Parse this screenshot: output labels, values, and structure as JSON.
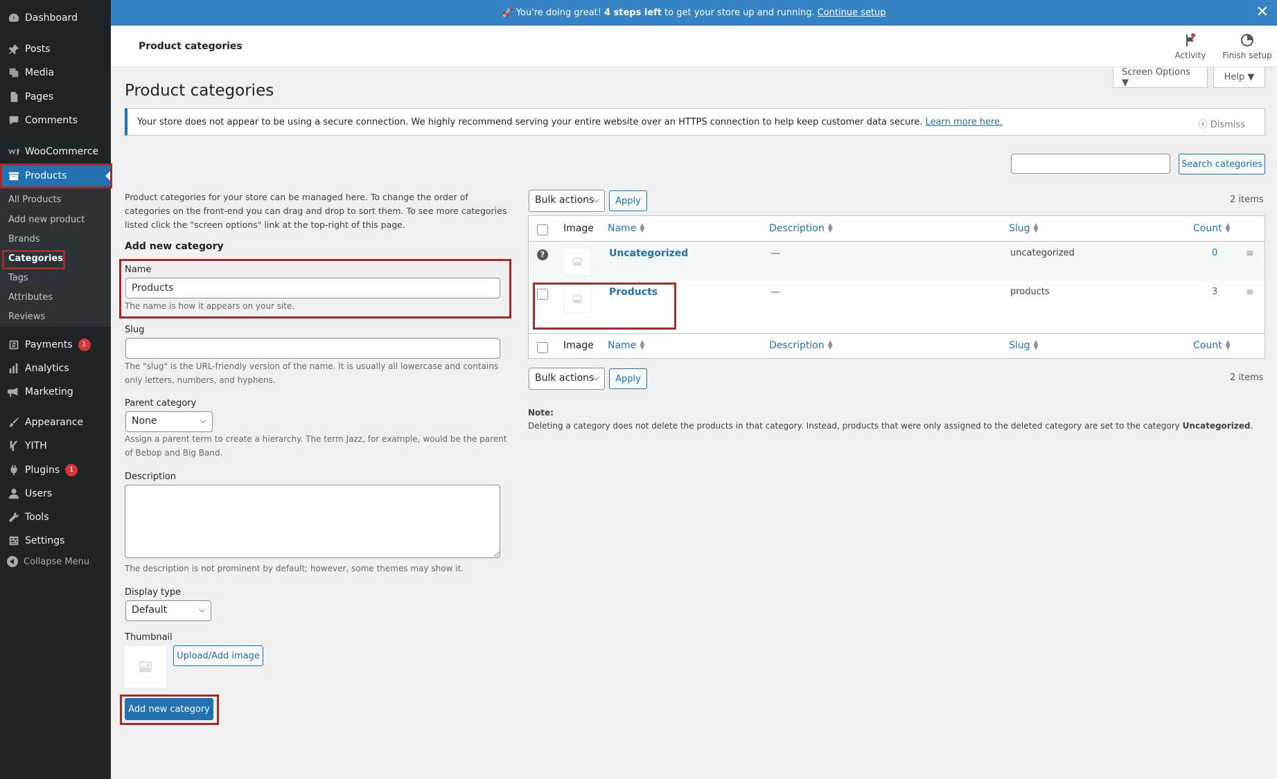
{
  "banner": {
    "prefix": "🚀 You're doing great!",
    "bold": "4 steps left",
    "middle": "to get your store up and running.",
    "link": "Continue setup"
  },
  "sidebar": {
    "items": [
      {
        "label": "Dashboard",
        "icon": "dashboard-icon"
      },
      {
        "label": "Posts",
        "icon": "pin-icon"
      },
      {
        "label": "Media",
        "icon": "media-icon"
      },
      {
        "label": "Pages",
        "icon": "pages-icon"
      },
      {
        "label": "Comments",
        "icon": "comments-icon"
      },
      {
        "label": "WooCommerce",
        "icon": "woocommerce-icon"
      },
      {
        "label": "Products",
        "icon": "archive-icon"
      },
      {
        "label": "Payments",
        "icon": "payments-icon",
        "badge": "1"
      },
      {
        "label": "Analytics",
        "icon": "analytics-icon"
      },
      {
        "label": "Marketing",
        "icon": "megaphone-icon"
      },
      {
        "label": "Appearance",
        "icon": "brush-icon"
      },
      {
        "label": "YITH",
        "icon": "yith-icon"
      },
      {
        "label": "Plugins",
        "icon": "plugins-icon",
        "badge": "1"
      },
      {
        "label": "Users",
        "icon": "users-icon"
      },
      {
        "label": "Tools",
        "icon": "tools-icon"
      },
      {
        "label": "Settings",
        "icon": "settings-icon"
      }
    ],
    "submenu": [
      "All Products",
      "Add new product",
      "Brands",
      "Categories",
      "Tags",
      "Attributes",
      "Reviews"
    ],
    "collapse": "Collapse Menu"
  },
  "header": {
    "title": "Product categories",
    "activity": "Activity",
    "finish_setup": "Finish setup"
  },
  "screen_options": "Screen Options ▼",
  "help": "Help ▼",
  "page_title": "Product categories",
  "notice": {
    "text": "Your store does not appear to be using a secure connection. We highly recommend serving your entire website over an HTTPS connection to help keep customer data secure.",
    "link": "Learn more here.",
    "dismiss": "Dismiss"
  },
  "search": {
    "value": "",
    "button": "Search categories"
  },
  "form": {
    "intro": "Product categories for your store can be managed here. To change the order of categories on the front-end you can drag and drop to sort them. To see more categories listed click the \"screen options\" link at the top-right of this page.",
    "heading": "Add new category",
    "name_label": "Name",
    "name_value": "Products",
    "name_hint": "The name is how it appears on your site.",
    "slug_label": "Slug",
    "slug_value": "",
    "slug_hint": "The \"slug\" is the URL-friendly version of the name. It is usually all lowercase and contains only letters, numbers, and hyphens.",
    "parent_label": "Parent category",
    "parent_value": "None",
    "parent_hint": "Assign a parent term to create a hierarchy. The term Jazz, for example, would be the parent of Bebop and Big Band.",
    "description_label": "Description",
    "description_value": "",
    "description_hint": "The description is not prominent by default; however, some themes may show it.",
    "display_label": "Display type",
    "display_value": "Default",
    "thumbnail_label": "Thumbnail",
    "upload_button": "Upload/Add image",
    "submit": "Add new category"
  },
  "table": {
    "bulk_actions": "Bulk actions",
    "apply": "Apply",
    "items_count": "2 items",
    "columns": {
      "image": "Image",
      "name": "Name",
      "description": "Description",
      "slug": "Slug",
      "count": "Count"
    },
    "rows": [
      {
        "name": "Uncategorized",
        "description": "—",
        "slug": "uncategorized",
        "count": "0"
      },
      {
        "name": "Products",
        "description": "—",
        "slug": "products",
        "count": "3"
      }
    ]
  },
  "note": {
    "label": "Note:",
    "text": "Deleting a category does not delete the products in that category. Instead, products that were only assigned to the deleted category are set to the category",
    "bold": "Uncategorized",
    "end": "."
  },
  "colors": {
    "accent": "#2271b1",
    "sidebar": "#1d2327",
    "banner": "#3582c4",
    "highlight": "#a32b2b"
  }
}
